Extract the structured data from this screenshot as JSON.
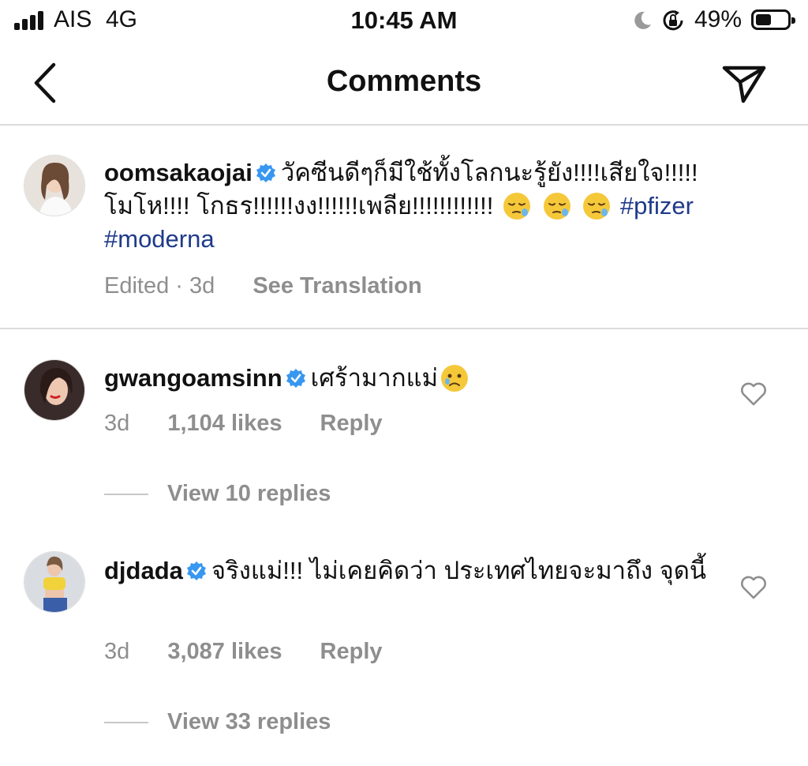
{
  "status_bar": {
    "carrier": "AIS",
    "network": "4G",
    "time": "10:45 AM",
    "battery_percent": "49%",
    "battery_level": 0.49
  },
  "header": {
    "title": "Comments"
  },
  "caption": {
    "username": "oomsakaojai",
    "text": "วัคซีนดีๆก็มีใช้ทั้งโลกนะรู้ยัง!!!!เสียใจ!!!!! โมโห!!!! โกธร!!!!!!งง!!!!!!เพลีย!!!!!!!!!!!!",
    "emojis": [
      "sleepy-face",
      "sleepy-face",
      "sleepy-face"
    ],
    "hashtag_1": "#pfizer",
    "hashtag_2": "#moderna",
    "edited": "Edited",
    "time": "3d",
    "translate": "See Translation"
  },
  "comments": [
    {
      "username": "gwangoamsinn",
      "text": "เศร้ามากแม่",
      "emoji": "crying-face",
      "time": "3d",
      "likes": "1,104 likes",
      "reply": "Reply",
      "view_replies": "View 10 replies"
    },
    {
      "username": "djdada",
      "text": "จริงแม่!!! ไม่เคยคิดว่า ประเทศไทยจะมาถึง จุดนี้",
      "time": "3d",
      "likes": "3,087 likes",
      "reply": "Reply",
      "view_replies": "View 33 replies"
    }
  ],
  "colors": {
    "hashtag": "#1e3a8a",
    "verified": "#3897f0",
    "meta_text": "#8e8e8e",
    "divider": "#dbdbdb"
  }
}
